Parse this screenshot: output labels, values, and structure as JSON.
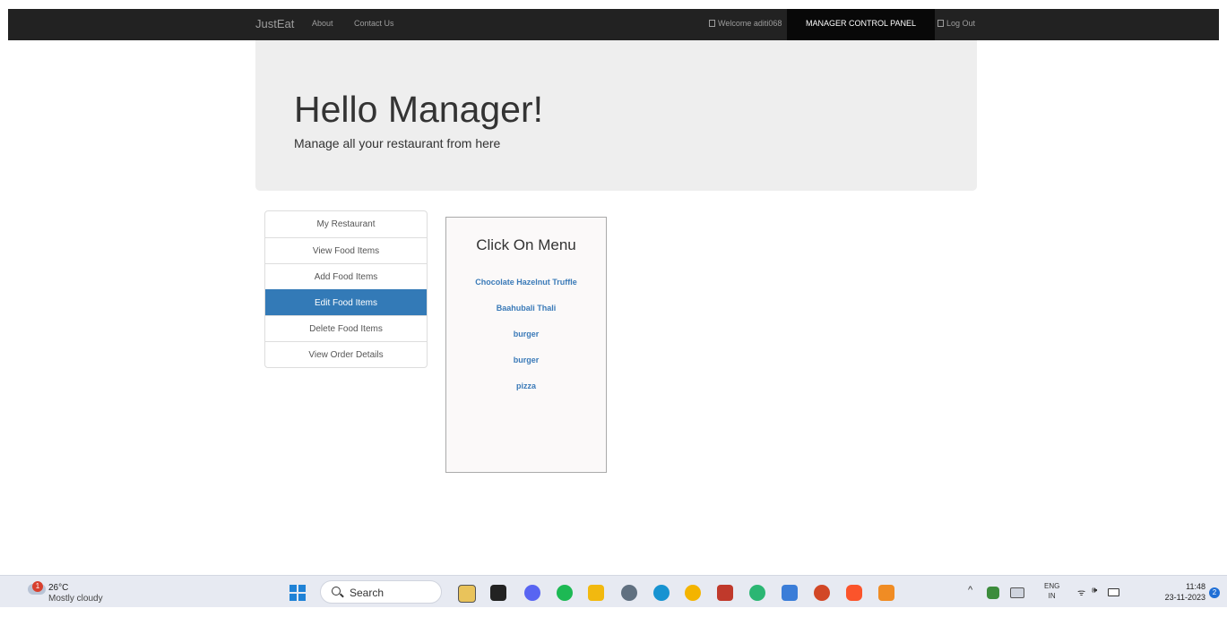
{
  "navbar": {
    "brand": "JustEat",
    "links": [
      "About",
      "Contact Us"
    ],
    "welcome": "Welcome aditi068",
    "panel": "MANAGER CONTROL PANEL",
    "logout": "Log Out"
  },
  "jumbotron": {
    "title": "Hello Manager!",
    "subtitle": "Manage all your restaurant from here"
  },
  "sidebar": {
    "items": [
      {
        "label": "My Restaurant"
      },
      {
        "label": "View Food Items"
      },
      {
        "label": "Add Food Items"
      },
      {
        "label": "Edit Food Items"
      },
      {
        "label": "Delete Food Items"
      },
      {
        "label": "View Order Details"
      }
    ],
    "active_index": 3
  },
  "menu": {
    "title": "Click On Menu",
    "items": [
      "Chocolate Hazelnut Truffle",
      "Baahubali Thali",
      "burger",
      "burger",
      "pizza"
    ]
  },
  "taskbar": {
    "weather_badge": "1",
    "temperature": "26°C",
    "weather": "Mostly cloudy",
    "search": "Search",
    "lang_top": "ENG",
    "lang_bottom": "IN",
    "time": "11:48",
    "date": "23-11-2023",
    "notifications": "2"
  },
  "colors": {
    "navbar": "#222222",
    "active": "#337ab7",
    "menu_link": "#3a7ab8"
  }
}
